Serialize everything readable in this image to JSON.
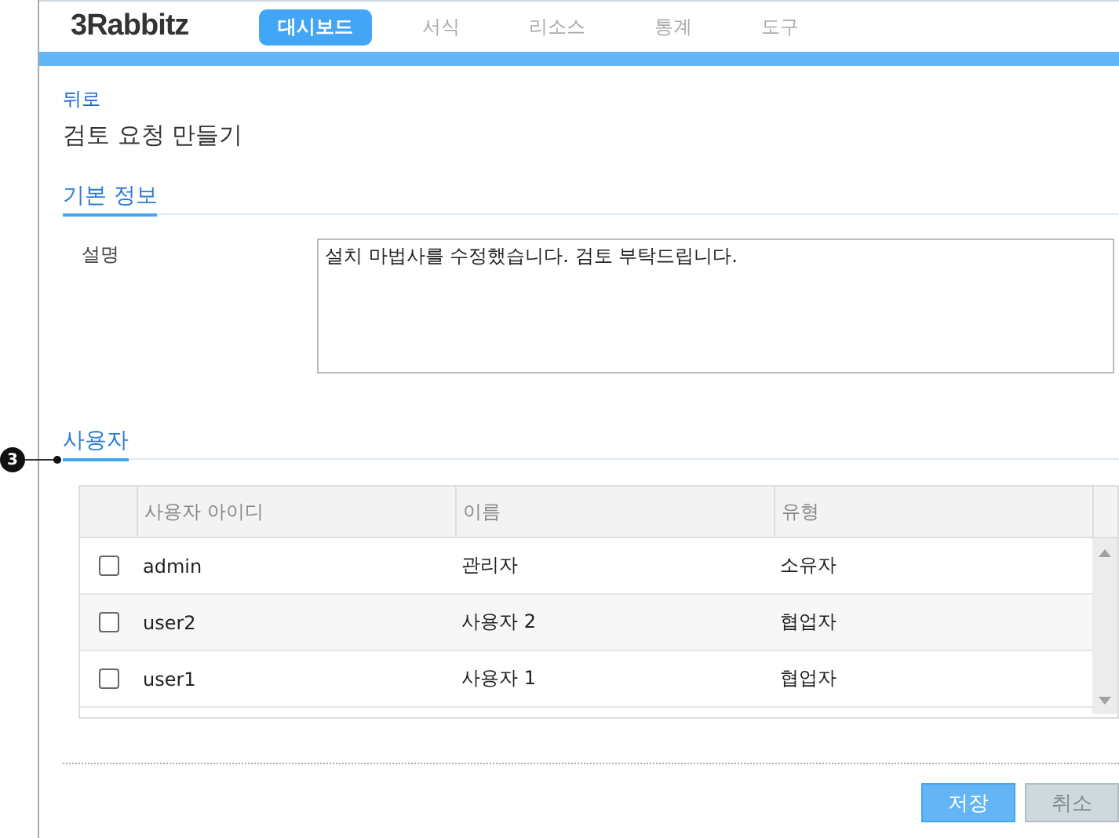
{
  "logo": "3Rabbitz",
  "nav": [
    {
      "label": "대시보드",
      "selected": true
    },
    {
      "label": "서식",
      "selected": false
    },
    {
      "label": "리소스",
      "selected": false
    },
    {
      "label": "통계",
      "selected": false
    },
    {
      "label": "도구",
      "selected": false
    }
  ],
  "back_link": "뒤로",
  "page_title": "검토 요청 만들기",
  "basic_section": {
    "title": "기본 정보",
    "field_label": "설명",
    "field_value": "설치 마법사를 수정했습니다. 검토 부탁드립니다."
  },
  "callout": "3",
  "users_section": {
    "title": "사용자",
    "columns": [
      "사용자 아이디",
      "이름",
      "유형"
    ],
    "rows": [
      {
        "checked": false,
        "cells": [
          "admin",
          "관리자",
          "소유자"
        ]
      },
      {
        "checked": false,
        "cells": [
          "user2",
          "사용자 2",
          "협업자"
        ]
      },
      {
        "checked": false,
        "cells": [
          "user1",
          "사용자 1",
          "협업자"
        ]
      }
    ]
  },
  "buttons": [
    {
      "label": "저장",
      "kind": "primary"
    },
    {
      "label": "취소",
      "kind": "disabled"
    }
  ]
}
